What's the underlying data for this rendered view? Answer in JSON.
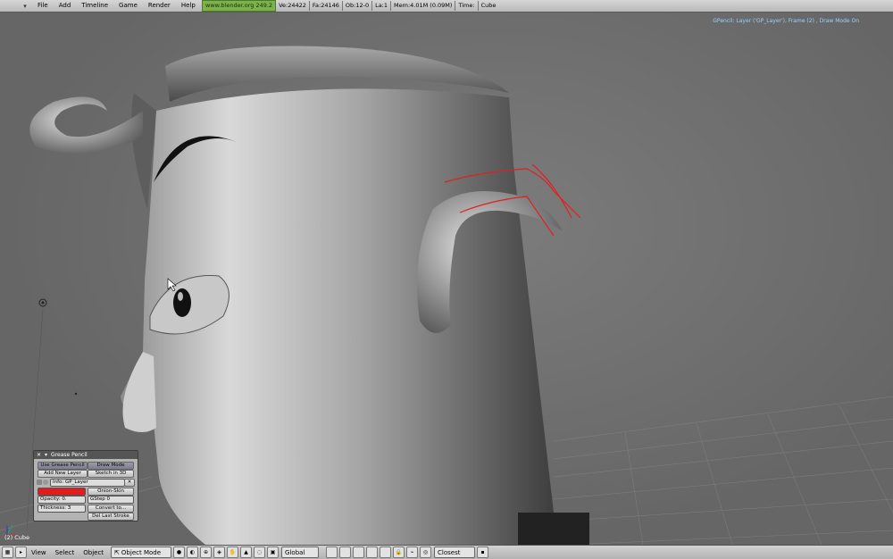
{
  "menu": {
    "items": [
      "File",
      "Add",
      "Timeline",
      "Game",
      "Render",
      "Help"
    ]
  },
  "info": {
    "url": "www.blender.org 249.2",
    "verts": "Ve:24422",
    "faces": "Fa:24146",
    "objects": "Ob:12-0",
    "lamps": "La:1",
    "mem": "Mem:4.01M (0.09M)",
    "time": "Time:",
    "object": "Cube"
  },
  "viewport": {
    "gp_status": "GPencil: Layer ('GP_Layer'), Frame (2) , Draw Mode On",
    "object_label": "(2) Cube"
  },
  "grease_panel": {
    "title": "Grease Pencil",
    "use_label": "Use Grease Pencil",
    "draw_mode_label": "Draw Mode",
    "add_layer_label": "Add New Layer",
    "sketch_label": "Sketch in 3D",
    "layer_info": "Info: GP_Layer",
    "opacity_label": "Opacity: 0.",
    "onion_label": "Onion-Skin",
    "gstep_label": "GStep 0",
    "thickness_label": "Thickness: 3",
    "convert_label": "Convert to...",
    "del_stroke_label": "Del Last Stroke",
    "stroke_color": "#e51b1b"
  },
  "bottom": {
    "view": "View",
    "select": "Select",
    "object": "Object",
    "mode": "Object Mode",
    "orientation": "Global",
    "snap": "Closest"
  },
  "colors": {
    "stroke": "#e02020",
    "viewport_bg": "#6f6f6f"
  }
}
